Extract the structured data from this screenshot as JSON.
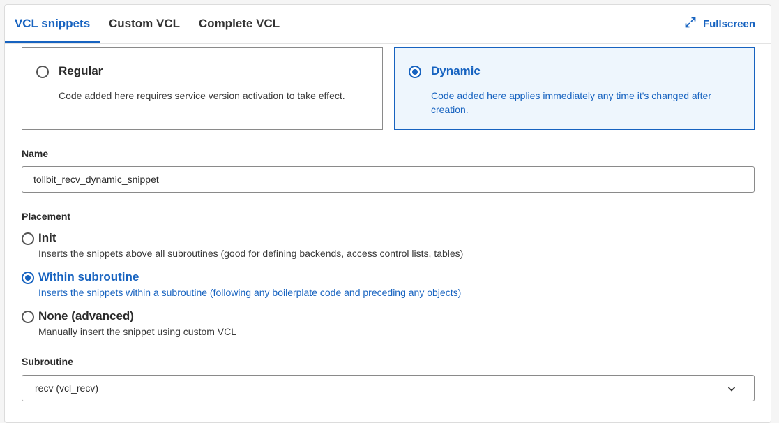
{
  "tabs": [
    {
      "label": "VCL snippets",
      "active": true
    },
    {
      "label": "Custom VCL",
      "active": false
    },
    {
      "label": "Complete VCL",
      "active": false
    }
  ],
  "fullscreen": {
    "label": "Fullscreen",
    "icon": "expand-icon"
  },
  "snippet_type": {
    "regular": {
      "title": "Regular",
      "description": "Code added here requires service version activation to take effect.",
      "selected": false
    },
    "dynamic": {
      "title": "Dynamic",
      "description": "Code added here applies immediately any time it's changed after creation.",
      "selected": true
    }
  },
  "name_field": {
    "label": "Name",
    "value": "tollbit_recv_dynamic_snippet"
  },
  "placement": {
    "label": "Placement",
    "options": [
      {
        "title": "Init",
        "description": "Inserts the snippets above all subroutines (good for defining backends, access control lists, tables)",
        "selected": false
      },
      {
        "title": "Within subroutine",
        "description": "Inserts the snippets within a subroutine (following any boilerplate code and preceding any objects)",
        "selected": true
      },
      {
        "title": "None (advanced)",
        "description": "Manually insert the snippet using custom VCL",
        "selected": false
      }
    ]
  },
  "subroutine": {
    "label": "Subroutine",
    "selected_value": "recv (vcl_recv)"
  },
  "colors": {
    "accent": "#1763c0",
    "selected_card_bg": "#eef6fd"
  }
}
